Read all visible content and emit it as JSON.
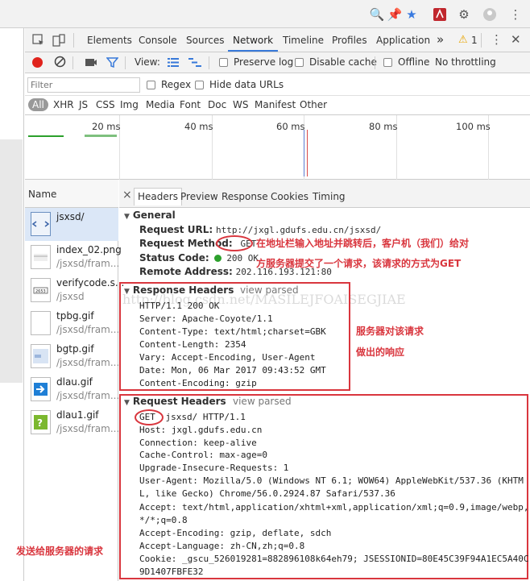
{
  "devtools": {
    "tabs": [
      "Elements",
      "Console",
      "Sources",
      "Network",
      "Timeline",
      "Profiles",
      "Application"
    ],
    "more": "»",
    "warning_count": "1",
    "toolbar": {
      "view_label": "View:",
      "preserve_log": "Preserve log",
      "disable_cache": "Disable cache",
      "offline": "Offline",
      "throttling": "No throttling"
    },
    "filter": {
      "placeholder": "Filter",
      "regex": "Regex",
      "hide_data_urls": "Hide data URLs"
    },
    "types": [
      "All",
      "XHR",
      "JS",
      "CSS",
      "Img",
      "Media",
      "Font",
      "Doc",
      "WS",
      "Manifest",
      "Other"
    ],
    "timeline_ticks": [
      "20 ms",
      "40 ms",
      "60 ms",
      "80 ms",
      "100 ms"
    ]
  },
  "requests": {
    "column_header": "Name",
    "items": [
      {
        "name": "jsxsd/",
        "path": ""
      },
      {
        "name": "index_02.png",
        "path": "/jsxsd/fram..."
      },
      {
        "name": "verifycode.s...",
        "path": "/jsxsd"
      },
      {
        "name": "tpbg.gif",
        "path": "/jsxsd/fram..."
      },
      {
        "name": "bgtp.gif",
        "path": "/jsxsd/fram..."
      },
      {
        "name": "dlau.gif",
        "path": "/jsxsd/fram..."
      },
      {
        "name": "dlau1.gif",
        "path": "/jsxsd/fram..."
      }
    ]
  },
  "details": {
    "close": "×",
    "tabs": [
      "Headers",
      "Preview",
      "Response",
      "Cookies",
      "Timing"
    ],
    "general": {
      "title": "General",
      "request_url_label": "Request URL:",
      "request_url": "http://jxgl.gdufs.edu.cn/jsxsd/",
      "request_method_label": "Request Method:",
      "request_method": "GET",
      "status_code_label": "Status Code:",
      "status_code": "200 OK",
      "remote_address_label": "Remote Address:",
      "remote_address": "202.116.193.121:80"
    },
    "response_headers": {
      "title": "Response Headers",
      "view_parsed": "view parsed",
      "lines": [
        "HTTP/1.1 200 OK",
        "Server: Apache-Coyote/1.1",
        "Content-Type: text/html;charset=GBK",
        "Content-Length: 2354",
        "Vary: Accept-Encoding, User-Agent",
        "Date: Mon, 06 Mar 2017 09:43:52 GMT",
        "Content-Encoding: gzip"
      ]
    },
    "request_headers": {
      "title": "Request Headers",
      "view_parsed": "view parsed",
      "first_method": "GET",
      "first_rest": "jsxsd/ HTTP/1.1",
      "lines": [
        "Host: jxgl.gdufs.edu.cn",
        "Connection: keep-alive",
        "Cache-Control: max-age=0",
        "Upgrade-Insecure-Requests: 1",
        "User-Agent: Mozilla/5.0 (Windows NT 6.1; WOW64) AppleWebKit/537.36 (KHTM",
        "L, like Gecko) Chrome/56.0.2924.87 Safari/537.36",
        "Accept: text/html,application/xhtml+xml,application/xml;q=0.9,image/webp,",
        "*/*;q=0.8",
        "Accept-Encoding: gzip, deflate, sdch",
        "Accept-Language: zh-CN,zh;q=0.8",
        "Cookie: _gscu_526019281=882896108k64eh79; JSESSIONID=80E45C39F94A1EC5A40C",
        "9D1407FBFE32"
      ]
    }
  },
  "annotations": {
    "get_note_1": "在地址栏输入地址并跳转后，客户机（我们）给对",
    "get_note_2": "方服务器提交了一个请求，该请求的方式为GET",
    "response_note_1": "服务器对该请求",
    "response_note_2": "做出的响应",
    "request_note": "发送给服务器的请求",
    "watermark": "http://blog.csdn.net/MASILEJFOAISEGJIAE"
  },
  "colors": {
    "accent_blue": "#3879d9",
    "annotation_red": "#d9363e",
    "status_green": "#2ca02c",
    "record_red": "#e0231c"
  }
}
